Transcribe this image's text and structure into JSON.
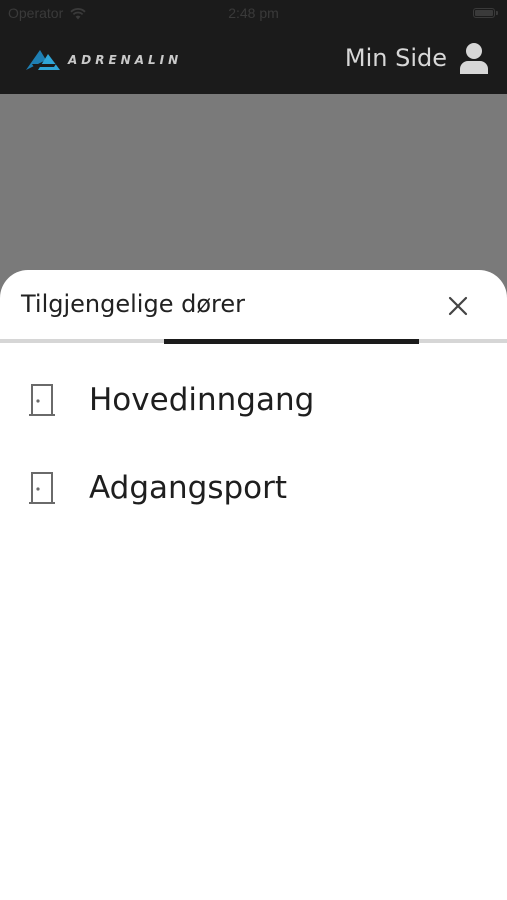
{
  "status_bar": {
    "carrier": "Operator",
    "time": "2:48 pm"
  },
  "header": {
    "logo_text": "ADRENALIN",
    "account_label": "Min Side",
    "brand_color": "#1b1b1b",
    "logo_accent": "#1e7fb3"
  },
  "sheet": {
    "title": "Tilgjengelige dører",
    "doors": [
      {
        "label": "Hovedinngang",
        "icon": "door-icon"
      },
      {
        "label": "Adgangsport",
        "icon": "door-icon"
      }
    ]
  }
}
